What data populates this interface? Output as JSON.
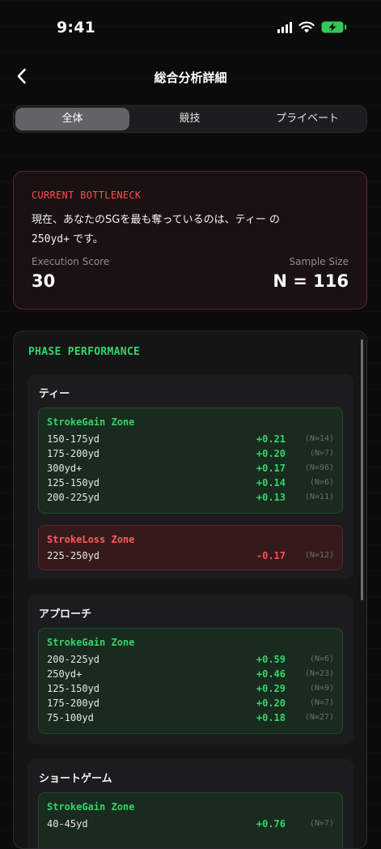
{
  "status": {
    "time": "9:41"
  },
  "nav": {
    "title": "総合分析詳細"
  },
  "tabs": [
    {
      "label": "全体",
      "active": true
    },
    {
      "label": "競技",
      "active": false
    },
    {
      "label": "プライベート",
      "active": false
    }
  ],
  "bottleneck": {
    "label": "CURRENT BOTTLENECK",
    "text_before": "現在、あなたのSGを最も奪っているのは、ティー の",
    "text_mono": "250yd+",
    "text_after": " です。",
    "exec_label": "Execution Score",
    "exec_value": "30",
    "sample_label": "Sample Size",
    "sample_value": "N = 116"
  },
  "phase": {
    "title": "PHASE PERFORMANCE",
    "groups": [
      {
        "title": "ティー",
        "gain_title": "StrokeGain Zone",
        "gain_rows": [
          {
            "range": "150-175yd",
            "value": "+0.21",
            "n": "(N=14)"
          },
          {
            "range": "175-200yd",
            "value": "+0.20",
            "n": "(N=7)"
          },
          {
            "range": "300yd+",
            "value": "+0.17",
            "n": "(N=96)"
          },
          {
            "range": "125-150yd",
            "value": "+0.14",
            "n": "(N=6)"
          },
          {
            "range": "200-225yd",
            "value": "+0.13",
            "n": "(N=11)"
          }
        ],
        "loss_title": "StrokeLoss Zone",
        "loss_rows": [
          {
            "range": "225-250yd",
            "value": "-0.17",
            "n": "(N=12)"
          }
        ]
      },
      {
        "title": "アプローチ",
        "gain_title": "StrokeGain Zone",
        "gain_rows": [
          {
            "range": "200-225yd",
            "value": "+0.59",
            "n": "(N=6)"
          },
          {
            "range": "250yd+",
            "value": "+0.46",
            "n": "(N=23)"
          },
          {
            "range": "125-150yd",
            "value": "+0.29",
            "n": "(N=9)"
          },
          {
            "range": "175-200yd",
            "value": "+0.20",
            "n": "(N=7)"
          },
          {
            "range": "75-100yd",
            "value": "+0.18",
            "n": "(N=27)"
          }
        ]
      },
      {
        "title": "ショートゲーム",
        "gain_title": "StrokeGain Zone",
        "gain_rows": [
          {
            "range": "40-45yd",
            "value": "+0.76",
            "n": "(N=7)"
          }
        ]
      }
    ]
  },
  "colors": {
    "accent_green": "#34d46b",
    "accent_red": "#ff4d4f",
    "background": "#0b0b0c"
  },
  "icons": {
    "back": "chevron-left-icon",
    "signal": "cellular-signal-icon",
    "wifi": "wifi-icon",
    "battery": "battery-charging-icon"
  }
}
